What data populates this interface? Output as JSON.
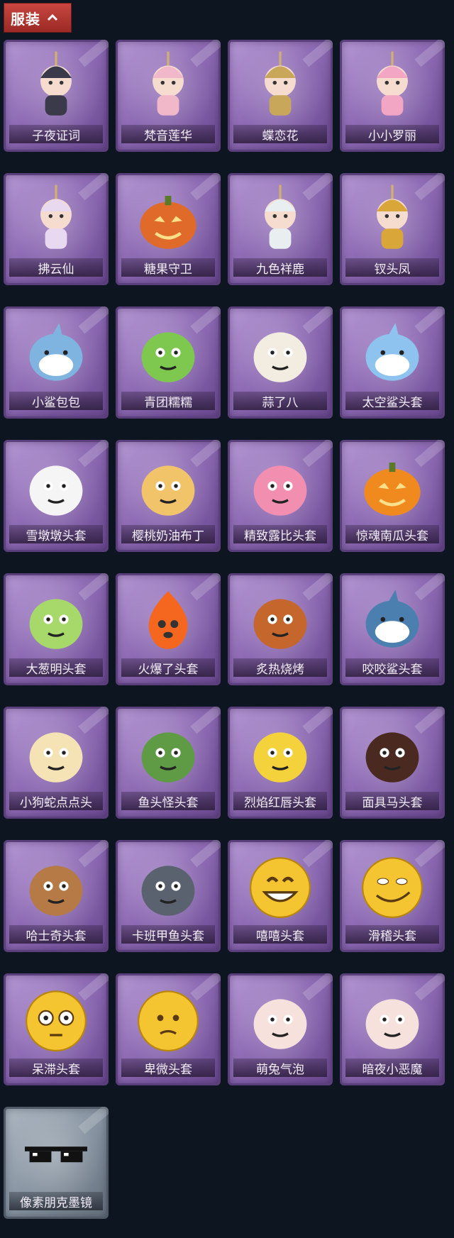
{
  "header": {
    "label": "服装",
    "toggle_icon": "chevron-up-icon",
    "color": "#b5332d"
  },
  "items": [
    {
      "name": "子夜证词",
      "icon": "masked-bird-icon",
      "rarity": "purple",
      "color": "#3a3a4a"
    },
    {
      "name": "梵音莲华",
      "icon": "doll-icon",
      "rarity": "purple",
      "color": "#f0b8c8"
    },
    {
      "name": "蝶恋花",
      "icon": "bell-charm-icon",
      "rarity": "purple",
      "color": "#c9a75a"
    },
    {
      "name": "小小罗丽",
      "icon": "doll-icon",
      "rarity": "purple",
      "color": "#f3a6c4"
    },
    {
      "name": "拂云仙",
      "icon": "charm-icon",
      "rarity": "purple",
      "color": "#e8d9f0"
    },
    {
      "name": "糖果守卫",
      "icon": "pumpkin-charm-icon",
      "rarity": "purple",
      "color": "#e06a2a"
    },
    {
      "name": "九色祥鹿",
      "icon": "deer-icon",
      "rarity": "purple",
      "color": "#e9eef0"
    },
    {
      "name": "钗头凤",
      "icon": "doll-icon",
      "rarity": "purple",
      "color": "#d9a63a"
    },
    {
      "name": "小鲨包包",
      "icon": "shark-bag-icon",
      "rarity": "purple",
      "color": "#7fb3e0"
    },
    {
      "name": "青团糯糯",
      "icon": "rice-ball-icon",
      "rarity": "purple",
      "color": "#7ec850"
    },
    {
      "name": "蒜了八",
      "icon": "garlic-icon",
      "rarity": "purple",
      "color": "#f3ece0"
    },
    {
      "name": "太空鲨头套",
      "icon": "shark-head-icon",
      "rarity": "purple",
      "color": "#8fc3ef"
    },
    {
      "name": "雪墩墩头套",
      "icon": "snowman-head-icon",
      "rarity": "purple",
      "color": "#f5f5f5"
    },
    {
      "name": "樱桃奶油布丁",
      "icon": "pudding-icon",
      "rarity": "purple",
      "color": "#f2c46a"
    },
    {
      "name": "精致露比头套",
      "icon": "pink-creature-icon",
      "rarity": "purple",
      "color": "#f28fb0"
    },
    {
      "name": "惊魂南瓜头套",
      "icon": "pumpkin-icon",
      "rarity": "purple",
      "color": "#f08a1e"
    },
    {
      "name": "大葱明头套",
      "icon": "scallion-icon",
      "rarity": "purple",
      "color": "#a6d86a"
    },
    {
      "name": "火爆了头套",
      "icon": "fire-icon",
      "rarity": "purple",
      "color": "#f5671e"
    },
    {
      "name": "炙热烧烤",
      "icon": "meat-icon",
      "rarity": "purple",
      "color": "#c5662d"
    },
    {
      "name": "咬咬鲨头套",
      "icon": "shark-icon",
      "rarity": "purple",
      "color": "#4b7fb0"
    },
    {
      "name": "小狗蛇点点头",
      "icon": "snake-icon",
      "rarity": "purple",
      "color": "#f6e3b5"
    },
    {
      "name": "鱼头怪头套",
      "icon": "fish-head-icon",
      "rarity": "purple",
      "color": "#5f9a45"
    },
    {
      "name": "烈焰红唇头套",
      "icon": "yellow-creature-icon",
      "rarity": "purple",
      "color": "#f4d23b"
    },
    {
      "name": "面具马头套",
      "icon": "horse-head-icon",
      "rarity": "purple",
      "color": "#4a2a20"
    },
    {
      "name": "哈士奇头套",
      "icon": "dog-head-icon",
      "rarity": "purple",
      "color": "#b57a45"
    },
    {
      "name": "卡班甲鱼头套",
      "icon": "fish-icon",
      "rarity": "purple",
      "color": "#5a6270"
    },
    {
      "name": "嘻嘻头套",
      "icon": "grin-emoji-icon",
      "rarity": "purple",
      "color": "#f5c431"
    },
    {
      "name": "滑稽头套",
      "icon": "smirk-emoji-icon",
      "rarity": "purple",
      "color": "#f5c431"
    },
    {
      "name": "呆滞头套",
      "icon": "stare-emoji-icon",
      "rarity": "purple",
      "color": "#f5c431"
    },
    {
      "name": "卑微头套",
      "icon": "meek-emoji-icon",
      "rarity": "purple",
      "color": "#f5c431"
    },
    {
      "name": "萌兔气泡",
      "icon": "bubble-head-icon",
      "rarity": "purple",
      "color": "#f7e1dc"
    },
    {
      "name": "暗夜小恶魔",
      "icon": "devil-head-icon",
      "rarity": "purple",
      "color": "#f7e1dc"
    },
    {
      "name": "像素朋克墨镜",
      "icon": "pixel-sunglasses-icon",
      "rarity": "gray",
      "color": "#111111"
    }
  ]
}
